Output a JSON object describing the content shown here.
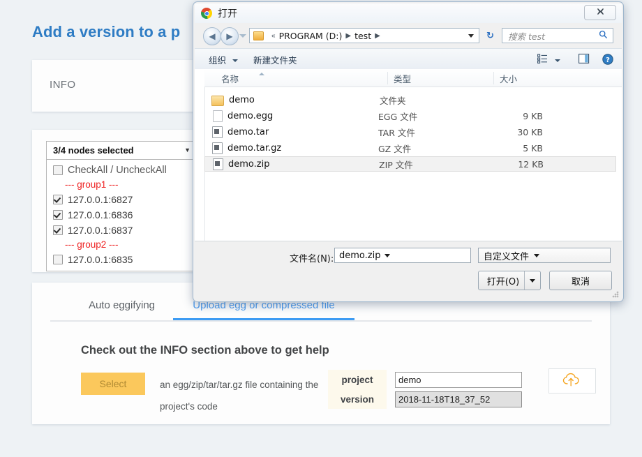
{
  "page": {
    "title": "Add a version to a p",
    "info_label": "INFO",
    "nodes": {
      "summary": "3/4 nodes selected",
      "check_all_label": "CheckAll / UncheckAll",
      "items": [
        {
          "type": "group",
          "label": "--- group1 ---"
        },
        {
          "type": "node",
          "label": "127.0.0.1:6827",
          "checked": true
        },
        {
          "type": "node",
          "label": "127.0.0.1:6836",
          "checked": true
        },
        {
          "type": "node",
          "label": "127.0.0.1:6837",
          "checked": true
        },
        {
          "type": "group",
          "label": "--- group2 ---"
        },
        {
          "type": "node",
          "label": "127.0.0.1:6835",
          "checked": false
        }
      ]
    },
    "tabs": [
      {
        "label": "Auto eggifying",
        "active": false
      },
      {
        "label": "Upload egg or compressed file",
        "active": true
      }
    ],
    "help_heading": "Check out the INFO section above to get help",
    "select_button": "Select",
    "description": "an egg/zip/tar/tar.gz file containing the project's code",
    "fields": [
      {
        "key": "project",
        "value": "demo",
        "disabled": false
      },
      {
        "key": "version",
        "value": "2018-11-18T18_37_52",
        "disabled": true
      }
    ],
    "upload_icon": "cloud-upload-icon",
    "accent_color": "#3d9bf3",
    "title_color": "#2e7cc4",
    "select_button_color": "#fbc85c"
  },
  "dialog": {
    "title": "打开",
    "close_label": "✕",
    "nav": {
      "back_icon": "arrow-left-icon",
      "forward_icon": "arrow-right-icon",
      "recent_icon": "chevron-down-icon",
      "breadcrumbs": [
        "PROGRAM (D:)",
        "test"
      ],
      "breadcrumb_prefix": "«",
      "refresh_icon": "refresh-icon",
      "search_placeholder": "搜索 test",
      "search_icon": "search-icon"
    },
    "toolbar": {
      "organize": "组织",
      "new_folder": "新建文件夹",
      "view_icon": "list-view-icon",
      "pane_icon": "preview-pane-icon",
      "help_icon": "help-icon"
    },
    "columns": [
      "名称",
      "类型",
      "大小"
    ],
    "files": [
      {
        "name": "demo",
        "type": "文件夹",
        "size": "",
        "icon": "folder-icon",
        "selected": false
      },
      {
        "name": "demo.egg",
        "type": "EGG 文件",
        "size": "9 KB",
        "icon": "file-icon",
        "selected": false
      },
      {
        "name": "demo.tar",
        "type": "TAR 文件",
        "size": "30 KB",
        "icon": "archive-icon",
        "selected": false
      },
      {
        "name": "demo.tar.gz",
        "type": "GZ 文件",
        "size": "5 KB",
        "icon": "archive-icon",
        "selected": false
      },
      {
        "name": "demo.zip",
        "type": "ZIP 文件",
        "size": "12 KB",
        "icon": "archive-icon",
        "selected": true
      }
    ],
    "footer": {
      "filename_label": "文件名(N):",
      "filename_value": "demo.zip",
      "filetype_value": "自定义文件",
      "open_button": "打开(O)",
      "cancel_button": "取消"
    }
  }
}
